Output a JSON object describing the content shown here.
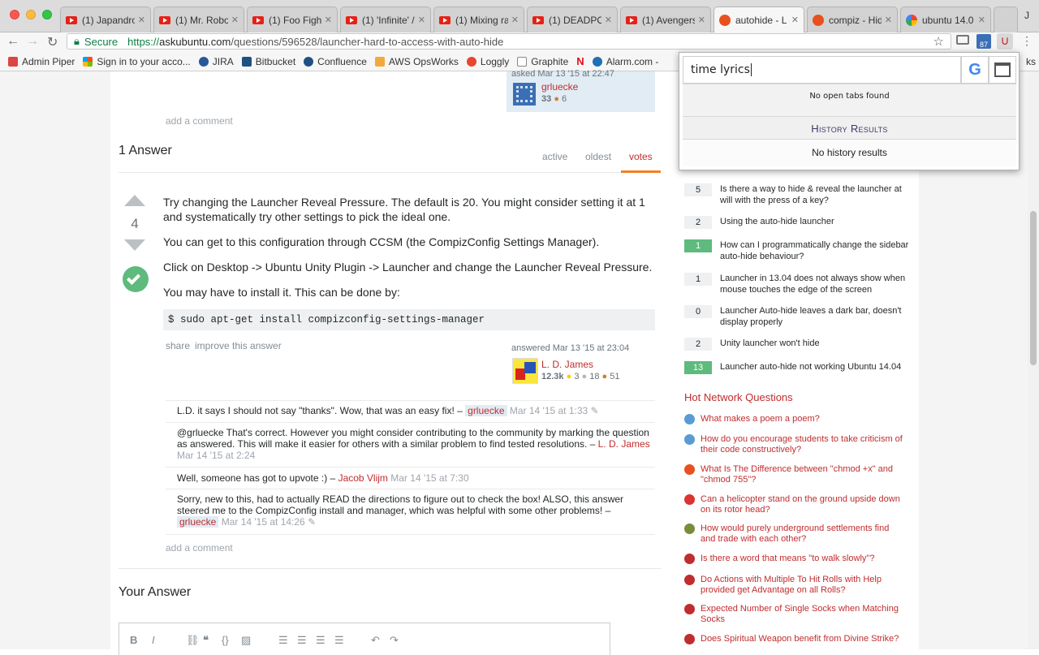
{
  "tabs": [
    {
      "label": "(1) Japandro",
      "icon": "youtube-icon"
    },
    {
      "label": "(1) Mr. Robo",
      "icon": "youtube-icon"
    },
    {
      "label": "(1) Foo Fight",
      "icon": "youtube-icon"
    },
    {
      "label": "(1) 'Infinite' /",
      "icon": "youtube-icon"
    },
    {
      "label": "(1) Mixing ra",
      "icon": "youtube-icon"
    },
    {
      "label": "(1) DEADPO",
      "icon": "youtube-icon"
    },
    {
      "label": "(1) Avengers",
      "icon": "youtube-icon"
    },
    {
      "label": "autohide - L",
      "icon": "askubuntu-icon"
    },
    {
      "label": "compiz - Hid",
      "icon": "askubuntu-icon"
    },
    {
      "label": "ubuntu 14.0",
      "icon": "google-icon"
    }
  ],
  "profile_initial": "J",
  "address": {
    "secure": "Secure",
    "scheme": "https://",
    "host": "askubuntu.com",
    "path": "/questions/596528/launcher-hard-to-access-with-auto-hide"
  },
  "extension_badge": "87",
  "bookmarks": [
    "Admin Piper",
    "Sign in to your acco...",
    "JIRA",
    "Bitbucket",
    "Confluence",
    "AWS OpsWorks",
    "Loggly",
    "Graphite",
    "Alarm.com -"
  ],
  "bookmarks_overflow": "ks",
  "question_owner": {
    "asked": "asked Mar 13 '15 at 22:47",
    "name": "grluecke",
    "rep": "33",
    "bronze": "6"
  },
  "add_comment": "add a comment",
  "answers_header": "1 Answer",
  "sort_tabs": [
    "active",
    "oldest",
    "votes"
  ],
  "answer": {
    "votes": "4",
    "paragraphs": [
      "Try changing the Launcher Reveal Pressure. The default is 20. You might consider setting it at 1 and systematically try other settings to pick the ideal one.",
      "You can get to this configuration through CCSM (the CompizConfig Settings Manager).",
      "Click on Desktop -> Ubuntu Unity Plugin -> Launcher and change the Launcher Reveal Pressure.",
      "You may have to install it. This can be done by:"
    ],
    "code": "$ sudo apt-get install compizconfig-settings-manager",
    "share": "share",
    "improve": "improve this answer",
    "answered": "answered Mar 13 '15 at 23:04",
    "author": "L. D. James",
    "author_rep": "12.3k",
    "gold": "3",
    "silver": "18",
    "bronze": "51"
  },
  "comments": [
    {
      "text": "L.D. it says I should not say \"thanks\". Wow, that was an easy fix! – ",
      "user": "grluecke",
      "date": "Mar 14 '15 at 1:33"
    },
    {
      "text": "@grluecke That's correct. However you might consider contributing to the community by marking the question as answered. This will make it easier for others with a similar problem to find tested resolutions. – ",
      "user": "L. D. James",
      "date": "Mar 14 '15 at 2:24"
    },
    {
      "text": "Well, someone has got to upvote :) – ",
      "user": "Jacob Vlijm",
      "date": "Mar 14 '15 at 7:30"
    },
    {
      "text": "Sorry, new to this, had to actually READ the directions to figure out to check the box! ALSO, this answer steered me to the CompizConfig install and manager, which was helpful with some other problems! – ",
      "user": "grluecke",
      "date": "Mar 14 '15 at 14:26"
    }
  ],
  "your_answer": "Your Answer",
  "related": [
    {
      "count": "5",
      "accepted": false,
      "title": "Is there a way to hide & reveal the launcher at will with the press of a key?"
    },
    {
      "count": "2",
      "accepted": false,
      "title": "Using the auto-hide launcher"
    },
    {
      "count": "1",
      "accepted": true,
      "title": "How can I programmatically change the sidebar auto-hide behaviour?"
    },
    {
      "count": "1",
      "accepted": false,
      "title": "Launcher in 13.04 does not always show when mouse touches the edge of the screen"
    },
    {
      "count": "0",
      "accepted": false,
      "title": "Launcher Auto-hide leaves a dark bar, doesn't display properly"
    },
    {
      "count": "2",
      "accepted": false,
      "title": "Unity launcher won't hide"
    },
    {
      "count": "13",
      "accepted": true,
      "title": "Launcher auto-hide not working Ubuntu 14.04"
    }
  ],
  "hot_header": "Hot Network Questions",
  "hot": [
    {
      "title": "What makes a poem a poem?",
      "color": "#5a9bd5"
    },
    {
      "title": "How do you encourage students to take criticism of their code constructively?",
      "color": "#5a9bd5"
    },
    {
      "title": "What Is The Difference between \"chmod +x\" and \"chmod 755\"?",
      "color": "#e9501f"
    },
    {
      "title": "Can a helicopter stand on the ground upside down on its rotor head?",
      "color": "#d33"
    },
    {
      "title": "How would purely underground settlements find and trade with each other?",
      "color": "#7a8c3c"
    },
    {
      "title": "Is there a word that means \"to walk slowly\"?",
      "color": "#c02d2e"
    },
    {
      "title": "Do Actions with Multiple To Hit Rolls with Help provided get Advantage on all Rolls?",
      "color": "#c02d2e"
    },
    {
      "title": "Expected Number of Single Socks when Matching Socks",
      "color": "#c02d2e"
    },
    {
      "title": "Does Spiritual Weapon benefit from Divine Strike?",
      "color": "#c02d2e"
    }
  ],
  "popup": {
    "query": "time lyrics",
    "no_tabs": "No open tabs found",
    "history_header": "History Results",
    "no_history": "No history results"
  },
  "colors": {
    "accent": "#f48024",
    "link_red": "#c02d2e",
    "accepted": "#5eba7d"
  }
}
